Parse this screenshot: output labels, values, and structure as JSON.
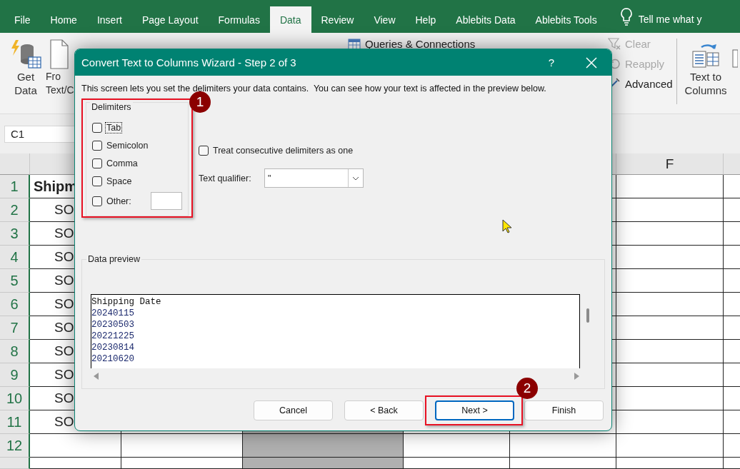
{
  "ribbon_tabs": [
    {
      "label": "File",
      "selected": false
    },
    {
      "label": "Home",
      "selected": false
    },
    {
      "label": "Insert",
      "selected": false
    },
    {
      "label": "Page Layout",
      "selected": false
    },
    {
      "label": "Formulas",
      "selected": false
    },
    {
      "label": "Data",
      "selected": true
    },
    {
      "label": "Review",
      "selected": false
    },
    {
      "label": "View",
      "selected": false
    },
    {
      "label": "Help",
      "selected": false
    },
    {
      "label": "Ablebits Data",
      "selected": false
    },
    {
      "label": "Ablebits Tools",
      "selected": false
    }
  ],
  "tell_me": "Tell me what y",
  "ribbon": {
    "get_data": {
      "line1": "Get",
      "line2": "Data"
    },
    "from_text": {
      "line1": "Fro",
      "line2": "Text/C"
    },
    "queries": "Queries & Connections",
    "filter_commands": [
      {
        "label": "Clear",
        "disabled": true
      },
      {
        "label": "Reapply",
        "disabled": true
      },
      {
        "label": "Advanced",
        "disabled": false
      }
    ],
    "text_to_columns": {
      "line1": "Text to",
      "line2": "Columns"
    }
  },
  "name_box": "C1",
  "sheet": {
    "columns": [
      {
        "selected": false
      },
      {
        "selected": false
      },
      {
        "selected": true
      },
      {
        "selected": false
      },
      {
        "selected": false
      },
      {
        "label": "F",
        "selected": false
      },
      {
        "selected": false
      }
    ],
    "rows": [
      {
        "number": "1",
        "kind": "header",
        "cells": [
          "Shipm"
        ]
      },
      {
        "number": "2",
        "kind": "data",
        "cells": [
          "SO"
        ]
      },
      {
        "number": "3",
        "kind": "data",
        "cells": [
          "SO"
        ]
      },
      {
        "number": "4",
        "kind": "data",
        "cells": [
          "SO"
        ]
      },
      {
        "number": "5",
        "kind": "data",
        "cells": [
          "SO"
        ]
      },
      {
        "number": "6",
        "kind": "data",
        "cells": [
          "SO"
        ]
      },
      {
        "number": "7",
        "kind": "data",
        "cells": [
          "SO"
        ]
      },
      {
        "number": "8",
        "kind": "data",
        "cells": [
          "SO"
        ]
      },
      {
        "number": "9",
        "kind": "data",
        "cells": [
          "SO"
        ]
      },
      {
        "number": "10",
        "kind": "data",
        "cells": [
          "SO"
        ]
      },
      {
        "number": "11",
        "kind": "data",
        "cells": [
          "SO"
        ]
      },
      {
        "number": "12",
        "kind": "data",
        "cells": []
      },
      {
        "kind": "data",
        "cells": []
      }
    ]
  },
  "dialog": {
    "title": "Convert Text to Columns Wizard - Step 2 of 3",
    "help": "?",
    "intro": "This screen lets you set the delimiters your data contains.  You can see how your text is affected in the preview below.",
    "delimiters": {
      "title": "Delimiters",
      "callout": "1",
      "items": [
        {
          "kind": "checkbox",
          "label": "Tab",
          "checked": false,
          "focused": true
        },
        {
          "kind": "checkbox",
          "label": "Semicolon",
          "checked": false,
          "focused": false
        },
        {
          "kind": "checkbox",
          "label": "Comma",
          "checked": false,
          "focused": false
        },
        {
          "kind": "checkbox",
          "label": "Space",
          "checked": false,
          "focused": false
        },
        {
          "kind": "checkbox_field",
          "label": "Other:",
          "checked": false,
          "focused": false
        }
      ]
    },
    "treat_consecutive": {
      "label": "Treat consecutive delimiters as one",
      "checked": false
    },
    "text_qualifier": {
      "label": "Text qualifier:",
      "value": "\""
    },
    "preview": {
      "title": "Data preview",
      "lines": [
        "Shipping Date",
        "20240115",
        "20230503",
        "20221225",
        "20230814",
        "20210620"
      ]
    },
    "buttons": [
      {
        "label": "Cancel",
        "default": false
      },
      {
        "label": "< Back",
        "default": false
      },
      {
        "label": "Next >",
        "default": true,
        "callout": "2"
      },
      {
        "label": "Finish",
        "default": false
      }
    ]
  }
}
